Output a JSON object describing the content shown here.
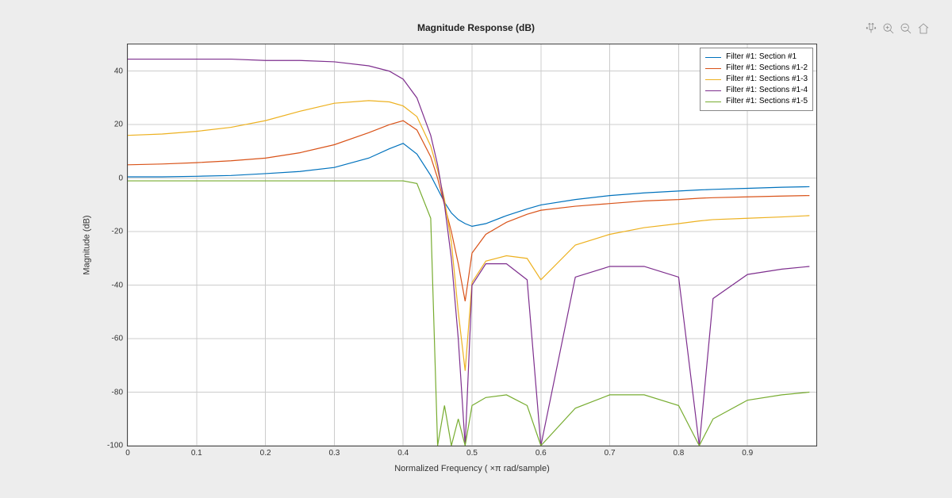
{
  "chart_data": {
    "type": "line",
    "title": "Magnitude Response (dB)",
    "xlabel": "Normalized  Frequency  ( ×π  rad/sample)",
    "ylabel": "Magnitude (dB)",
    "xlim": [
      0,
      1
    ],
    "ylim": [
      -100,
      50
    ],
    "xticks": [
      0,
      0.1,
      0.2,
      0.3,
      0.4,
      0.5,
      0.6,
      0.7,
      0.8,
      0.9
    ],
    "yticks": [
      -100,
      -80,
      -60,
      -40,
      -20,
      0,
      20,
      40
    ],
    "x": [
      0,
      0.05,
      0.1,
      0.15,
      0.2,
      0.25,
      0.3,
      0.35,
      0.38,
      0.4,
      0.42,
      0.44,
      0.45,
      0.46,
      0.47,
      0.48,
      0.49,
      0.5,
      0.52,
      0.55,
      0.58,
      0.6,
      0.65,
      0.7,
      0.75,
      0.8,
      0.83,
      0.85,
      0.9,
      0.95,
      0.99
    ],
    "series": [
      {
        "name": "Filter #1: Section #1",
        "color": "#0072BD",
        "values": [
          0.5,
          0.5,
          0.7,
          1,
          1.7,
          2.5,
          4,
          7.5,
          11,
          13,
          9,
          1,
          -4,
          -9,
          -13,
          -15.5,
          -17,
          -18,
          -17,
          -14,
          -11.5,
          -10,
          -8,
          -6.5,
          -5.5,
          -4.8,
          -4.4,
          -4.2,
          -3.8,
          -3.4,
          -3.2
        ]
      },
      {
        "name": "Filter #1: Sections #1-2",
        "color": "#D95319",
        "values": [
          5,
          5.3,
          5.8,
          6.5,
          7.5,
          9.5,
          12.5,
          17,
          20,
          21.5,
          18,
          8,
          0,
          -10,
          -20,
          -32,
          -46,
          -28,
          -21,
          -16.5,
          -13.5,
          -12,
          -10.5,
          -9.5,
          -8.5,
          -8,
          -7.5,
          -7.3,
          -7,
          -6.7,
          -6.5
        ]
      },
      {
        "name": "Filter #1: Sections #1-3",
        "color": "#EDB120",
        "values": [
          16,
          16.5,
          17.5,
          19,
          21.5,
          25,
          28,
          29,
          28.5,
          27,
          23,
          12,
          3,
          -8,
          -24,
          -50,
          -72,
          -39,
          -31,
          -29,
          -30,
          -38,
          -25,
          -21,
          -18.5,
          -17,
          -16,
          -15.5,
          -15,
          -14.5,
          -14
        ]
      },
      {
        "name": "Filter #1: Sections #1-4",
        "color": "#7E2F8E",
        "values": [
          44.5,
          44.5,
          44.5,
          44.5,
          44,
          44,
          43.5,
          42,
          40,
          37,
          30,
          16,
          5,
          -10,
          -30,
          -60,
          -100,
          -40,
          -32,
          -32,
          -38,
          -100,
          -37,
          -33,
          -33,
          -37,
          -100,
          -45,
          -36,
          -34,
          -33
        ]
      },
      {
        "name": "Filter #1: Sections #1-5",
        "color": "#77AC30",
        "values": [
          -1,
          -1,
          -1,
          -1,
          -1,
          -1,
          -1,
          -1,
          -1,
          -1,
          -2,
          -15,
          -100,
          -85,
          -100,
          -90,
          -100,
          -85,
          -82,
          -81,
          -85,
          -100,
          -86,
          -81,
          -81,
          -85,
          -100,
          -90,
          -83,
          -81,
          -80
        ]
      }
    ]
  },
  "toolbar": {
    "icons": [
      "pan-icon",
      "zoom-in-icon",
      "zoom-out-icon",
      "home-icon"
    ]
  }
}
